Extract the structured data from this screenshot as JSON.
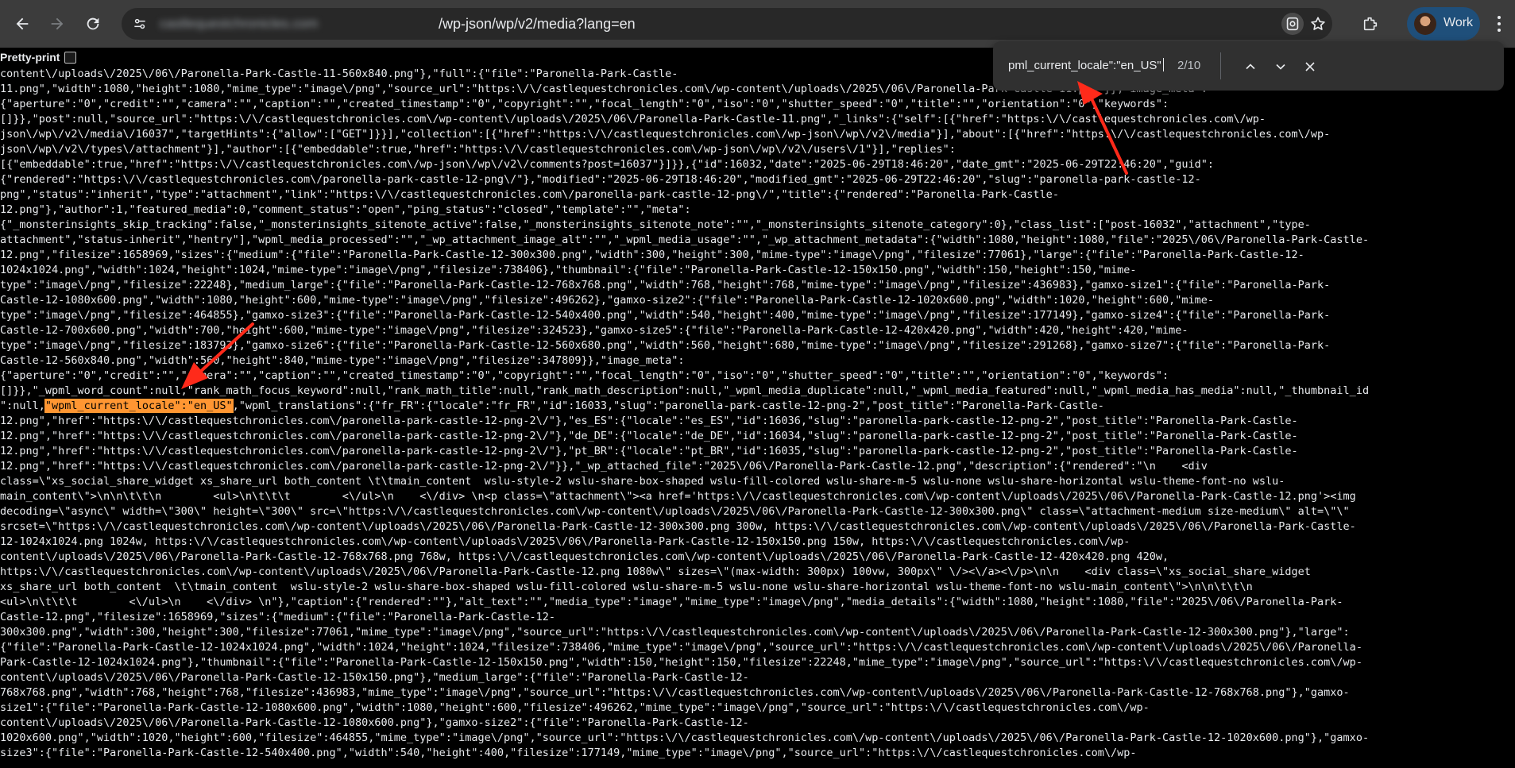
{
  "browser": {
    "url_host": "castlequestchronicles.com",
    "url_path": "/wp-json/wp/v2/media?lang=en",
    "profile_name": "Work",
    "icons": [
      "back-icon",
      "forward-icon",
      "reload-icon",
      "tune-icon",
      "google-lens-icon",
      "star-icon",
      "extensions-icon",
      "kebab-menu-icon"
    ]
  },
  "page": {
    "pretty_print_label": "Pretty-print"
  },
  "find_bar": {
    "query": "pml_current_locale\":\"en_US\"",
    "count": "2/10"
  },
  "json_lines": [
    {
      "t": "content\\/uploads\\/2025\\/06\\/Paronella-Park-Castle-11-560x840.png\"},\"full\":{\"file\":\"Paronella-Park-Castle-"
    },
    {
      "t": "11.png\",\"width\":1080,\"height\":1080,\"mime_type\":\"image\\/png\",\"source_url\":\"https:\\/\\/castlequestchronicles.com\\/wp-content\\/uploads\\/2025\\/06\\/Paronella-Park-Castle-11.png\"}},\"image_meta\":"
    },
    {
      "t": "{\"aperture\":\"0\",\"credit\":\"\",\"camera\":\"\",\"caption\":\"\",\"created_timestamp\":\"0\",\"copyright\":\"\",\"focal_length\":\"0\",\"iso\":\"0\",\"shutter_speed\":\"0\",\"title\":\"\",\"orientation\":\"0\",\"keywords\":"
    },
    {
      "t": "[]}},\"post\":null,\"source_url\":\"https:\\/\\/castlequestchronicles.com\\/wp-content\\/uploads\\/2025\\/06\\/Paronella-Park-Castle-11.png\",\"_links\":{\"self\":[{\"href\":\"https:\\/\\/castlequestchronicles.com\\/wp-"
    },
    {
      "t": "json\\/wp\\/v2\\/media\\/16037\",\"targetHints\":{\"allow\":[\"GET\"]}}],\"collection\":[{\"href\":\"https:\\/\\/castlequestchronicles.com\\/wp-json\\/wp\\/v2\\/media\"}],\"about\":[{\"href\":\"https:\\/\\/castlequestchronicles.com\\/wp-"
    },
    {
      "t": "json\\/wp\\/v2\\/types\\/attachment\"}],\"author\":[{\"embeddable\":true,\"href\":\"https:\\/\\/castlequestchronicles.com\\/wp-json\\/wp\\/v2\\/users\\/1\"}],\"replies\":"
    },
    {
      "t": "[{\"embeddable\":true,\"href\":\"https:\\/\\/castlequestchronicles.com\\/wp-json\\/wp\\/v2\\/comments?post=16037\"}]}},{\"id\":16032,\"date\":\"2025-06-29T18:46:20\",\"date_gmt\":\"2025-06-29T22:46:20\",\"guid\":"
    },
    {
      "t": "{\"rendered\":\"https:\\/\\/castlequestchronicles.com\\/paronella-park-castle-12-png\\/\"},\"modified\":\"2025-06-29T18:46:20\",\"modified_gmt\":\"2025-06-29T22:46:20\",\"slug\":\"paronella-park-castle-12-"
    },
    {
      "t": "png\",\"status\":\"inherit\",\"type\":\"attachment\",\"link\":\"https:\\/\\/castlequestchronicles.com\\/paronella-park-castle-12-png\\/\",\"title\":{\"rendered\":\"Paronella-Park-Castle-"
    },
    {
      "t": "12.png\"},\"author\":1,\"featured_media\":0,\"comment_status\":\"open\",\"ping_status\":\"closed\",\"template\":\"\",\"meta\":"
    },
    {
      "t": "{\"_monsterinsights_skip_tracking\":false,\"_monsterinsights_sitenote_active\":false,\"_monsterinsights_sitenote_note\":\"\",\"_monsterinsights_sitenote_category\":0},\"class_list\":[\"post-16032\",\"attachment\",\"type-"
    },
    {
      "t": "attachment\",\"status-inherit\",\"hentry\"],\"wpml_media_processed\":\"\",\"_wp_attachment_image_alt\":\"\",\"_wpml_media_usage\":\"\",\"_wp_attachment_metadata\":{\"width\":1080,\"height\":1080,\"file\":\"2025\\/06\\/Paronella-Park-Castle-"
    },
    {
      "t": "12.png\",\"filesize\":1658969,\"sizes\":{\"medium\":{\"file\":\"Paronella-Park-Castle-12-300x300.png\",\"width\":300,\"height\":300,\"mime-type\":\"image\\/png\",\"filesize\":77061},\"large\":{\"file\":\"Paronella-Park-Castle-12-"
    },
    {
      "t": "1024x1024.png\",\"width\":1024,\"height\":1024,\"mime-type\":\"image\\/png\",\"filesize\":738406},\"thumbnail\":{\"file\":\"Paronella-Park-Castle-12-150x150.png\",\"width\":150,\"height\":150,\"mime-"
    },
    {
      "t": "type\":\"image\\/png\",\"filesize\":22248},\"medium_large\":{\"file\":\"Paronella-Park-Castle-12-768x768.png\",\"width\":768,\"height\":768,\"mime-type\":\"image\\/png\",\"filesize\":436983},\"gamxo-size1\":{\"file\":\"Paronella-Park-"
    },
    {
      "t": "Castle-12-1080x600.png\",\"width\":1080,\"height\":600,\"mime-type\":\"image\\/png\",\"filesize\":496262},\"gamxo-size2\":{\"file\":\"Paronella-Park-Castle-12-1020x600.png\",\"width\":1020,\"height\":600,\"mime-"
    },
    {
      "t": "type\":\"image\\/png\",\"filesize\":464855},\"gamxo-size3\":{\"file\":\"Paronella-Park-Castle-12-540x400.png\",\"width\":540,\"height\":400,\"mime-type\":\"image\\/png\",\"filesize\":177149},\"gamxo-size4\":{\"file\":\"Paronella-Park-"
    },
    {
      "t": "Castle-12-700x600.png\",\"width\":700,\"height\":600,\"mime-type\":\"image\\/png\",\"filesize\":324523},\"gamxo-size5\":{\"file\":\"Paronella-Park-Castle-12-420x420.png\",\"width\":420,\"height\":420,\"mime-"
    },
    {
      "t": "type\":\"image\\/png\",\"filesize\":183793},\"gamxo-size6\":{\"file\":\"Paronella-Park-Castle-12-560x680.png\",\"width\":560,\"height\":680,\"mime-type\":\"image\\/png\",\"filesize\":291268},\"gamxo-size7\":{\"file\":\"Paronella-Park-"
    },
    {
      "t": "Castle-12-560x840.png\",\"width\":560,\"height\":840,\"mime-type\":\"image\\/png\",\"filesize\":347809}},\"image_meta\":"
    },
    {
      "t": "{\"aperture\":\"0\",\"credit\":\"\",\"camera\":\"\",\"caption\":\"\",\"created_timestamp\":\"0\",\"copyright\":\"\",\"focal_length\":\"0\",\"iso\":\"0\",\"shutter_speed\":\"0\",\"title\":\"\",\"orientation\":\"0\",\"keywords\":"
    },
    {
      "t": "[]}},\"_wpml_word_count\":null,\"rank_math_focus_keyword\":null,\"rank_math_title\":null,\"rank_math_description\":null,\"_wpml_media_duplicate\":null,\"_wpml_media_featured\":null,\"_wpml_media_has_media\":null,\"_thumbnail_id"
    },
    {
      "t": "\":null,",
      "hl": "\"wpml_current_locale\":\"en_US\"",
      "after": ",\"wpml_translations\":{\"fr_FR\":{\"locale\":\"fr_FR\",\"id\":16033,\"slug\":\"paronella-park-castle-12-png-2\",\"post_title\":\"Paronella-Park-Castle-"
    },
    {
      "t": "12.png\",\"href\":\"https:\\/\\/castlequestchronicles.com\\/paronella-park-castle-12-png-2\\/\"},\"es_ES\":{\"locale\":\"es_ES\",\"id\":16036,\"slug\":\"paronella-park-castle-12-png-2\",\"post_title\":\"Paronella-Park-Castle-"
    },
    {
      "t": "12.png\",\"href\":\"https:\\/\\/castlequestchronicles.com\\/paronella-park-castle-12-png-2\\/\"},\"de_DE\":{\"locale\":\"de_DE\",\"id\":16034,\"slug\":\"paronella-park-castle-12-png-2\",\"post_title\":\"Paronella-Park-Castle-"
    },
    {
      "t": "12.png\",\"href\":\"https:\\/\\/castlequestchronicles.com\\/paronella-park-castle-12-png-2\\/\"},\"pt_BR\":{\"locale\":\"pt_BR\",\"id\":16035,\"slug\":\"paronella-park-castle-12-png-2\",\"post_title\":\"Paronella-Park-Castle-"
    },
    {
      "t": "12.png\",\"href\":\"https:\\/\\/castlequestchronicles.com\\/paronella-park-castle-12-png-2\\/\"}},\"_wp_attached_file\":\"2025\\/06\\/Paronella-Park-Castle-12.png\",\"description\":{\"rendered\":\"\\n    <div"
    },
    {
      "t": "class=\\\"xs_social_share_widget xs_share_url both_content \\t\\tmain_content  wslu-style-2 wslu-share-box-shaped wslu-fill-colored wslu-share-m-5 wslu-none wslu-share-horizontal wslu-theme-font-no wslu-"
    },
    {
      "t": "main_content\\\">\\n\\n\\t\\t\\n        <ul>\\n\\t\\t\\t        <\\/ul>\\n    <\\/div> \\n<p class=\\\"attachment\\\"><a href='https:\\/\\/castlequestchronicles.com\\/wp-content\\/uploads\\/2025\\/06\\/Paronella-Park-Castle-12.png'><img"
    },
    {
      "t": "decoding=\\\"async\\\" width=\\\"300\\\" height=\\\"300\\\" src=\\\"https:\\/\\/castlequestchronicles.com\\/wp-content\\/uploads\\/2025\\/06\\/Paronella-Park-Castle-12-300x300.png\\\" class=\\\"attachment-medium size-medium\\\" alt=\\\"\\\""
    },
    {
      "t": "srcset=\\\"https:\\/\\/castlequestchronicles.com\\/wp-content\\/uploads\\/2025\\/06\\/Paronella-Park-Castle-12-300x300.png 300w, https:\\/\\/castlequestchronicles.com\\/wp-content\\/uploads\\/2025\\/06\\/Paronella-Park-Castle-"
    },
    {
      "t": "12-1024x1024.png 1024w, https:\\/\\/castlequestchronicles.com\\/wp-content\\/uploads\\/2025\\/06\\/Paronella-Park-Castle-12-150x150.png 150w, https:\\/\\/castlequestchronicles.com\\/wp-"
    },
    {
      "t": "content\\/uploads\\/2025\\/06\\/Paronella-Park-Castle-12-768x768.png 768w, https:\\/\\/castlequestchronicles.com\\/wp-content\\/uploads\\/2025\\/06\\/Paronella-Park-Castle-12-420x420.png 420w,"
    },
    {
      "t": "https:\\/\\/castlequestchronicles.com\\/wp-content\\/uploads\\/2025\\/06\\/Paronella-Park-Castle-12.png 1080w\\\" sizes=\\\"(max-width: 300px) 100vw, 300px\\\" \\/><\\/a><\\/p>\\n\\n    <div class=\\\"xs_social_share_widget"
    },
    {
      "t": "xs_share_url both_content  \\t\\tmain_content  wslu-style-2 wslu-share-box-shaped wslu-fill-colored wslu-share-m-5 wslu-none wslu-share-horizontal wslu-theme-font-no wslu-main_content\\\">\\n\\n\\t\\t\\n"
    },
    {
      "t": "<ul>\\n\\t\\t\\t        <\\/ul>\\n    <\\/div> \\n\"},\"caption\":{\"rendered\":\"\"},\"alt_text\":\"\",\"media_type\":\"image\",\"mime_type\":\"image\\/png\",\"media_details\":{\"width\":1080,\"height\":1080,\"file\":\"2025\\/06\\/Paronella-Park-"
    },
    {
      "t": "Castle-12.png\",\"filesize\":1658969,\"sizes\":{\"medium\":{\"file\":\"Paronella-Park-Castle-12-"
    },
    {
      "t": "300x300.png\",\"width\":300,\"height\":300,\"filesize\":77061,\"mime_type\":\"image\\/png\",\"source_url\":\"https:\\/\\/castlequestchronicles.com\\/wp-content\\/uploads\\/2025\\/06\\/Paronella-Park-Castle-12-300x300.png\"},\"large\":"
    },
    {
      "t": "{\"file\":\"Paronella-Park-Castle-12-1024x1024.png\",\"width\":1024,\"height\":1024,\"filesize\":738406,\"mime_type\":\"image\\/png\",\"source_url\":\"https:\\/\\/castlequestchronicles.com\\/wp-content\\/uploads\\/2025\\/06\\/Paronella-"
    },
    {
      "t": "Park-Castle-12-1024x1024.png\"},\"thumbnail\":{\"file\":\"Paronella-Park-Castle-12-150x150.png\",\"width\":150,\"height\":150,\"filesize\":22248,\"mime_type\":\"image\\/png\",\"source_url\":\"https:\\/\\/castlequestchronicles.com\\/wp-"
    },
    {
      "t": "content\\/uploads\\/2025\\/06\\/Paronella-Park-Castle-12-150x150.png\"},\"medium_large\":{\"file\":\"Paronella-Park-Castle-12-"
    },
    {
      "t": "768x768.png\",\"width\":768,\"height\":768,\"filesize\":436983,\"mime_type\":\"image\\/png\",\"source_url\":\"https:\\/\\/castlequestchronicles.com\\/wp-content\\/uploads\\/2025\\/06\\/Paronella-Park-Castle-12-768x768.png\"},\"gamxo-"
    },
    {
      "t": "size1\":{\"file\":\"Paronella-Park-Castle-12-1080x600.png\",\"width\":1080,\"height\":600,\"filesize\":496262,\"mime_type\":\"image\\/png\",\"source_url\":\"https:\\/\\/castlequestchronicles.com\\/wp-"
    },
    {
      "t": "content\\/uploads\\/2025\\/06\\/Paronella-Park-Castle-12-1080x600.png\"},\"gamxo-size2\":{\"file\":\"Paronella-Park-Castle-12-"
    },
    {
      "t": "1020x600.png\",\"width\":1020,\"height\":600,\"filesize\":464855,\"mime_type\":\"image\\/png\",\"source_url\":\"https:\\/\\/castlequestchronicles.com\\/wp-content\\/uploads\\/2025\\/06\\/Paronella-Park-Castle-12-1020x600.png\"},\"gamxo-"
    },
    {
      "t": "size3\":{\"file\":\"Paronella-Park-Castle-12-540x400.png\",\"width\":540,\"height\":400,\"filesize\":177149,\"mime_type\":\"image\\/png\",\"source_url\":\"https:\\/\\/castlequestchronicles.com\\/wp-"
    }
  ],
  "colors": {
    "toolbar": "#3c3c3c",
    "omnibox": "#282828",
    "page_bg": "#000000",
    "text": "#e8eaed",
    "highlight": "#ff9632",
    "arrow": "#ff2a1a"
  }
}
